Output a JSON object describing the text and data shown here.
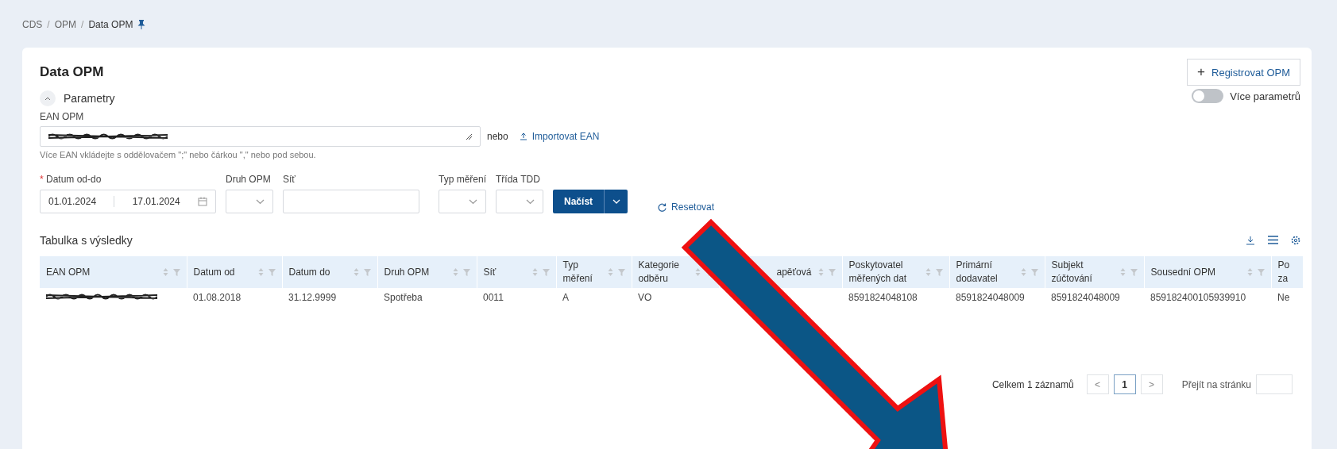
{
  "breadcrumb": {
    "separator": "/",
    "items": [
      {
        "label": "CDS",
        "current": false
      },
      {
        "label": "OPM",
        "current": false
      },
      {
        "label": "Data OPM",
        "current": true
      }
    ]
  },
  "page_title": "Data OPM",
  "register_button": {
    "icon": "+",
    "label": "Registrovat OPM"
  },
  "parameters": {
    "label": "Parametry",
    "expanded": true
  },
  "more_parameters": {
    "label": "Více parametrů",
    "on": false
  },
  "ean_field": {
    "label": "EAN OPM",
    "or_text": "nebo",
    "import_link": "Importovat EAN",
    "hint": "Více EAN vkládejte s oddělovačem \";\" nebo čárkou \",\" nebo pod sebou."
  },
  "required_mark": "*",
  "filters": [
    {
      "kind": "daterange",
      "label": "Datum od-do",
      "required": true,
      "from": "01.01.2024",
      "to": "17.01.2024"
    },
    {
      "kind": "select",
      "label": "Druh OPM",
      "required": false
    },
    {
      "kind": "text",
      "label": "Síť",
      "required": false
    },
    {
      "kind": "select",
      "label": "Typ měření",
      "required": false
    },
    {
      "kind": "select",
      "label": "Třída TDD",
      "required": false
    }
  ],
  "load_button": "Načíst",
  "reset_button": "Resetovat",
  "table": {
    "title": "Tabulka s výsledky",
    "columns": [
      "EAN OPM",
      "Datum od",
      "Datum do",
      "Druh OPM",
      "Síť",
      "Typ\nměření",
      "Kategorie\nodběru",
      "apěťová",
      "Poskytovatel\nměřených dat",
      "Primární\ndodavatel",
      "Subjekt\nzúčtování",
      "Sousední OPM",
      "Po\nza"
    ],
    "rows": [
      {
        "ean_redacted": true,
        "cells": [
          "",
          "01.08.2018",
          "31.12.9999",
          "Spotřeba",
          "0011",
          "A",
          "VO",
          "",
          "8591824048108",
          "8591824048009",
          "8591824048009",
          "859182400105939910",
          "Ne"
        ]
      }
    ]
  },
  "pagination": {
    "total": "Celkem 1 záznamů",
    "prev": "<",
    "pages": [
      {
        "label": "1",
        "selected": true
      }
    ],
    "next": ">",
    "goto_label": "Přejít na stránku"
  }
}
